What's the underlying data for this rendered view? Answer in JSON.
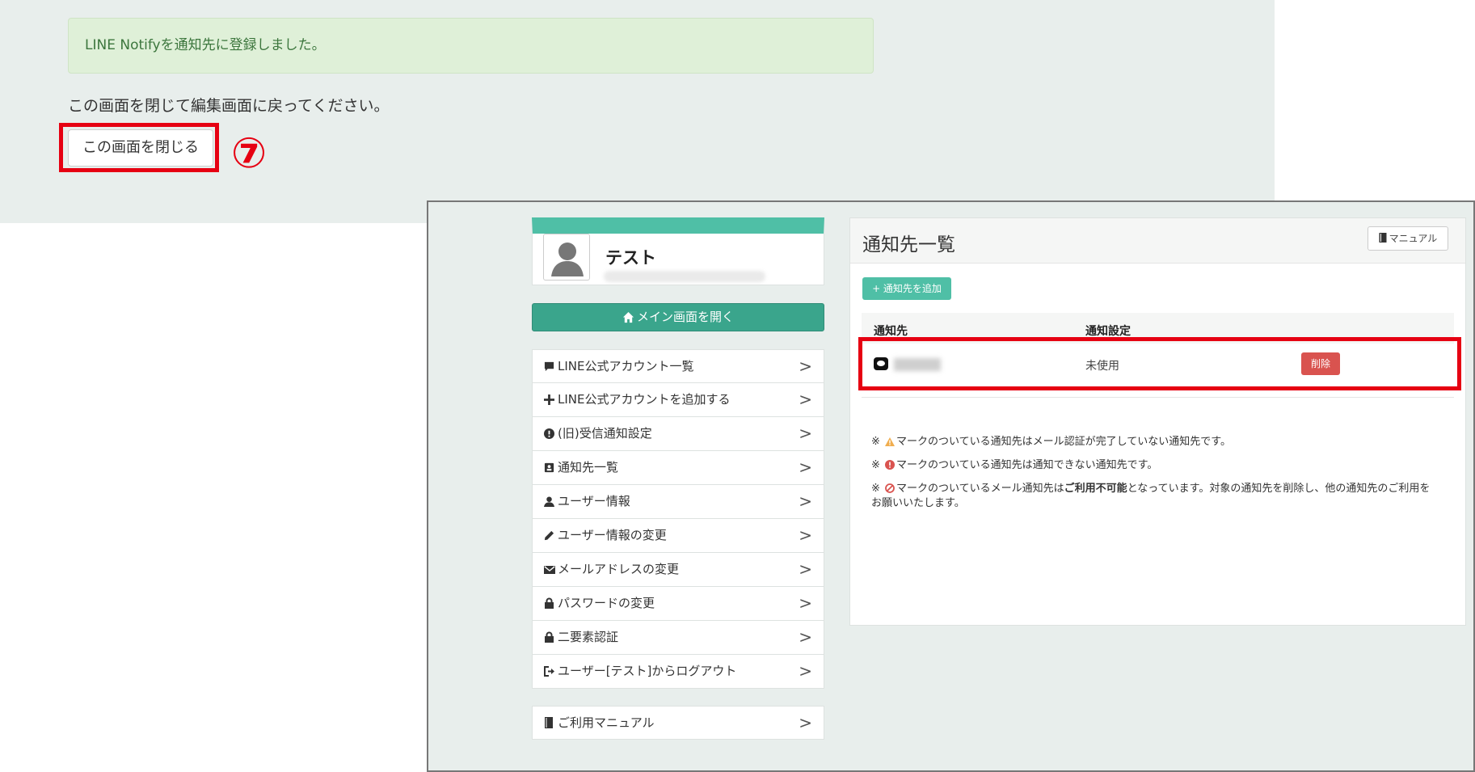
{
  "top": {
    "alert": "LINE Notifyを通知先に登録しました。",
    "instruction": "この画面を閉じて編集画面に戻ってください。",
    "close_button": "この画面を閉じる",
    "step_marker": "⑦"
  },
  "profile": {
    "name": "テスト"
  },
  "main_button": "メイン画面を開く",
  "menu": {
    "items": [
      {
        "label": "LINE公式アカウント一覧",
        "icon": "chat-icon"
      },
      {
        "label": "LINE公式アカウントを追加する",
        "icon": "plus-icon"
      },
      {
        "label": "(旧)受信通知設定",
        "icon": "alert-circle-icon"
      },
      {
        "label": "通知先一覧",
        "icon": "address-card-icon"
      },
      {
        "label": "ユーザー情報",
        "icon": "user-icon"
      },
      {
        "label": "ユーザー情報の変更",
        "icon": "pencil-icon"
      },
      {
        "label": "メールアドレスの変更",
        "icon": "envelope-icon"
      },
      {
        "label": "パスワードの変更",
        "icon": "lock-icon"
      },
      {
        "label": "二要素認証",
        "icon": "lock-icon"
      },
      {
        "label": "ユーザー[テスト]からログアウト",
        "icon": "logout-icon"
      }
    ],
    "manual": "ご利用マニュアル",
    "chevron": ">"
  },
  "panel": {
    "title": "通知先一覧",
    "manual_button": "マニュアル",
    "add_button": "+ 通知先を追加",
    "columns": [
      "通知先",
      "通知設定"
    ],
    "rows": [
      {
        "status": "未使用",
        "delete": "削除"
      }
    ],
    "notes": {
      "prefix": "※",
      "note1": "マークのついている通知先はメール認証が完了していない通知先です。",
      "note2": "マークのついている通知先は通知できない通知先です。",
      "note3_a": "マークのついているメール通知先は",
      "note3_bold": "ご利用不可能",
      "note3_b": "となっています。対象の通知先を削除し、他の通知先のご利用をお願いいたします。"
    }
  },
  "colors": {
    "accent": "#4fbfa6",
    "main_button": "#3aa58c",
    "highlight": "#e60012",
    "danger": "#d9534f",
    "success_bg": "#dff0d8",
    "warning": "#f0ad4e"
  }
}
